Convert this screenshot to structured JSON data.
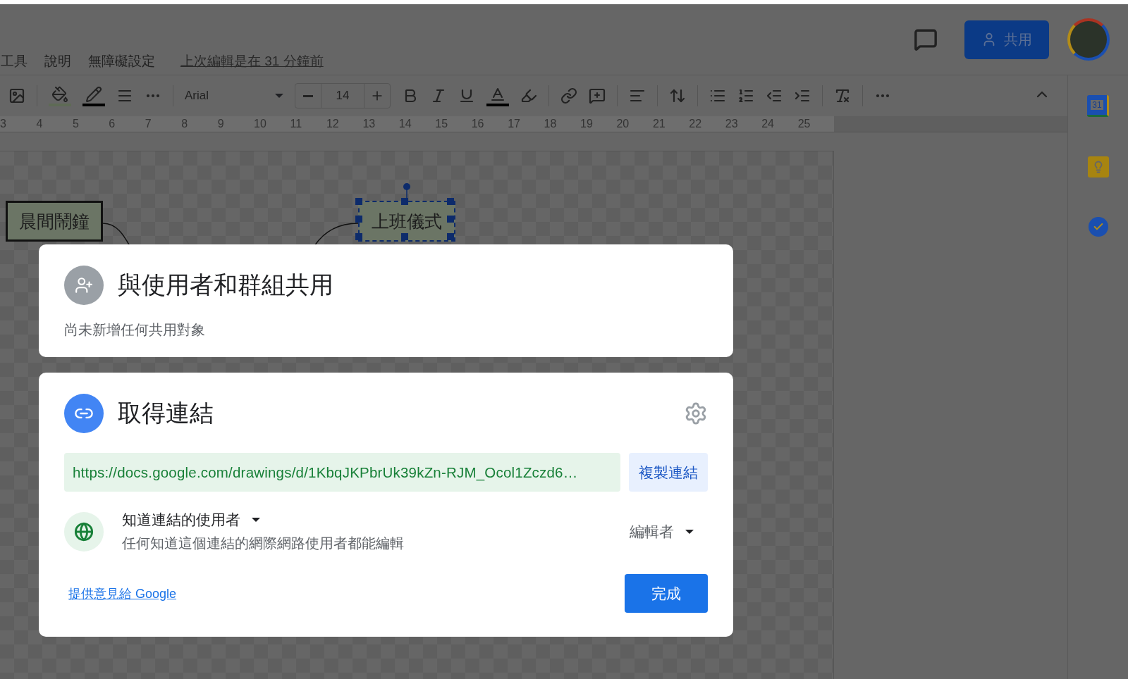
{
  "menu": [
    "工具",
    "說明",
    "無障礙設定"
  ],
  "last_edit": "上次編輯是在 31 分鐘前",
  "share_button": {
    "label": "共用"
  },
  "toolbar": {
    "font": "Arial",
    "font_size": "14"
  },
  "ruler": [
    "3",
    "4",
    "5",
    "6",
    "7",
    "8",
    "9",
    "10",
    "11",
    "12",
    "13",
    "14",
    "15",
    "16",
    "17",
    "18",
    "19",
    "20",
    "21",
    "22",
    "23",
    "24",
    "25"
  ],
  "side_panel": {
    "calendar_day": "31"
  },
  "canvas": {
    "nodes": [
      {
        "label": "晨間鬧鐘",
        "selected": false
      },
      {
        "label": "上班儀式",
        "selected": true
      }
    ]
  },
  "share_people": {
    "title": "與使用者和群組共用",
    "subtitle": "尚未新增任何共用對象"
  },
  "link_dialog": {
    "title": "取得連結",
    "url": "https://docs.google.com/drawings/d/1KbqJKPbrUk39kZn-RJM_Ocol1Zczd6…",
    "copy_button": "複製連結",
    "scope": "知道連結的使用者",
    "description": "任何知道這個連結的網際網路使用者都能編輯",
    "role": "編輯者",
    "feedback_link": "提供意見給 Google",
    "done_button": "完成"
  }
}
